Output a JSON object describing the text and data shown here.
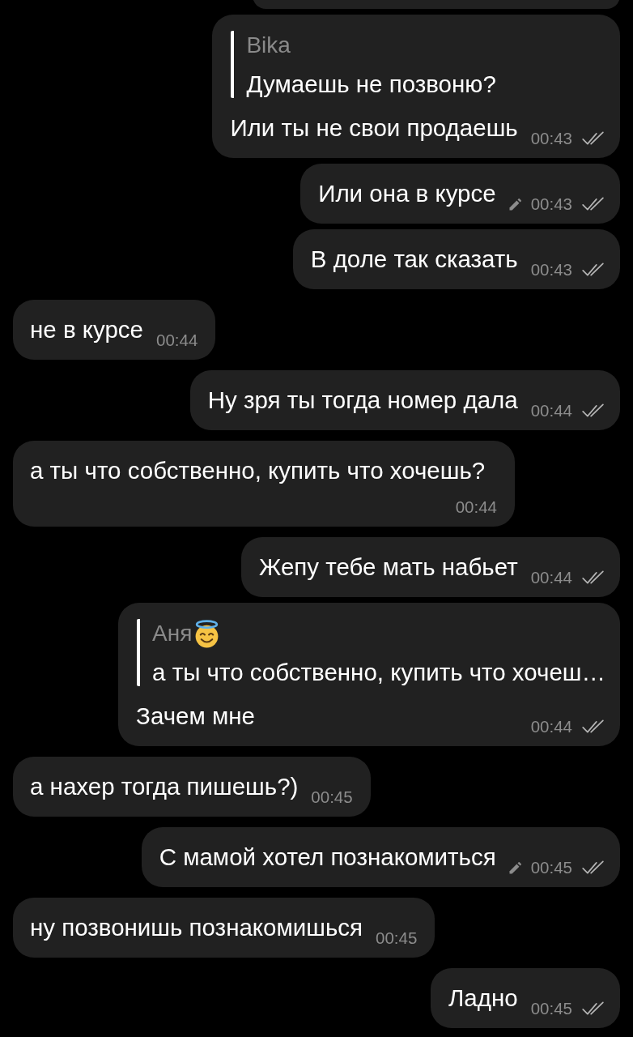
{
  "chat": {
    "clipped_message_above": true,
    "messages": [
      {
        "kind": "outgoing",
        "reply": {
          "author": "Bika",
          "author_emoji": false,
          "text": "Думаешь не позвоню?"
        },
        "text": "Или ты не свои продаешь",
        "time": "00:43",
        "edited": false,
        "read": true
      },
      {
        "kind": "outgoing",
        "text": "Или она в курсе",
        "time": "00:43",
        "edited": true,
        "read": true
      },
      {
        "kind": "outgoing",
        "text": "В доле так сказать",
        "time": "00:43",
        "edited": false,
        "read": true
      },
      {
        "kind": "incoming",
        "text": "не в курсе",
        "time": "00:44",
        "edited": false
      },
      {
        "kind": "outgoing",
        "text": "Ну зря ты тогда номер дала",
        "time": "00:44",
        "edited": false,
        "read": true
      },
      {
        "kind": "incoming",
        "text": "а ты что собственно, купить что хочешь?",
        "time": "00:44",
        "edited": false
      },
      {
        "kind": "outgoing",
        "text": "Жепу тебе мать набьет",
        "time": "00:44",
        "edited": false,
        "read": true
      },
      {
        "kind": "outgoing",
        "reply": {
          "author": "Аня",
          "author_emoji": true,
          "text": "а ты что собственно, купить что хочеш…"
        },
        "text": "Зачем мне",
        "time": "00:44",
        "edited": false,
        "read": true
      },
      {
        "kind": "incoming",
        "text": "а нахер тогда пишешь?)",
        "time": "00:45",
        "edited": false
      },
      {
        "kind": "outgoing",
        "text": "С мамой хотел познакомиться",
        "time": "00:45",
        "edited": true,
        "read": true
      },
      {
        "kind": "incoming",
        "text": "ну позвонишь познакомишься",
        "time": "00:45",
        "edited": false
      },
      {
        "kind": "outgoing",
        "text": "Ладно",
        "time": "00:45",
        "edited": false,
        "read": true
      }
    ]
  }
}
